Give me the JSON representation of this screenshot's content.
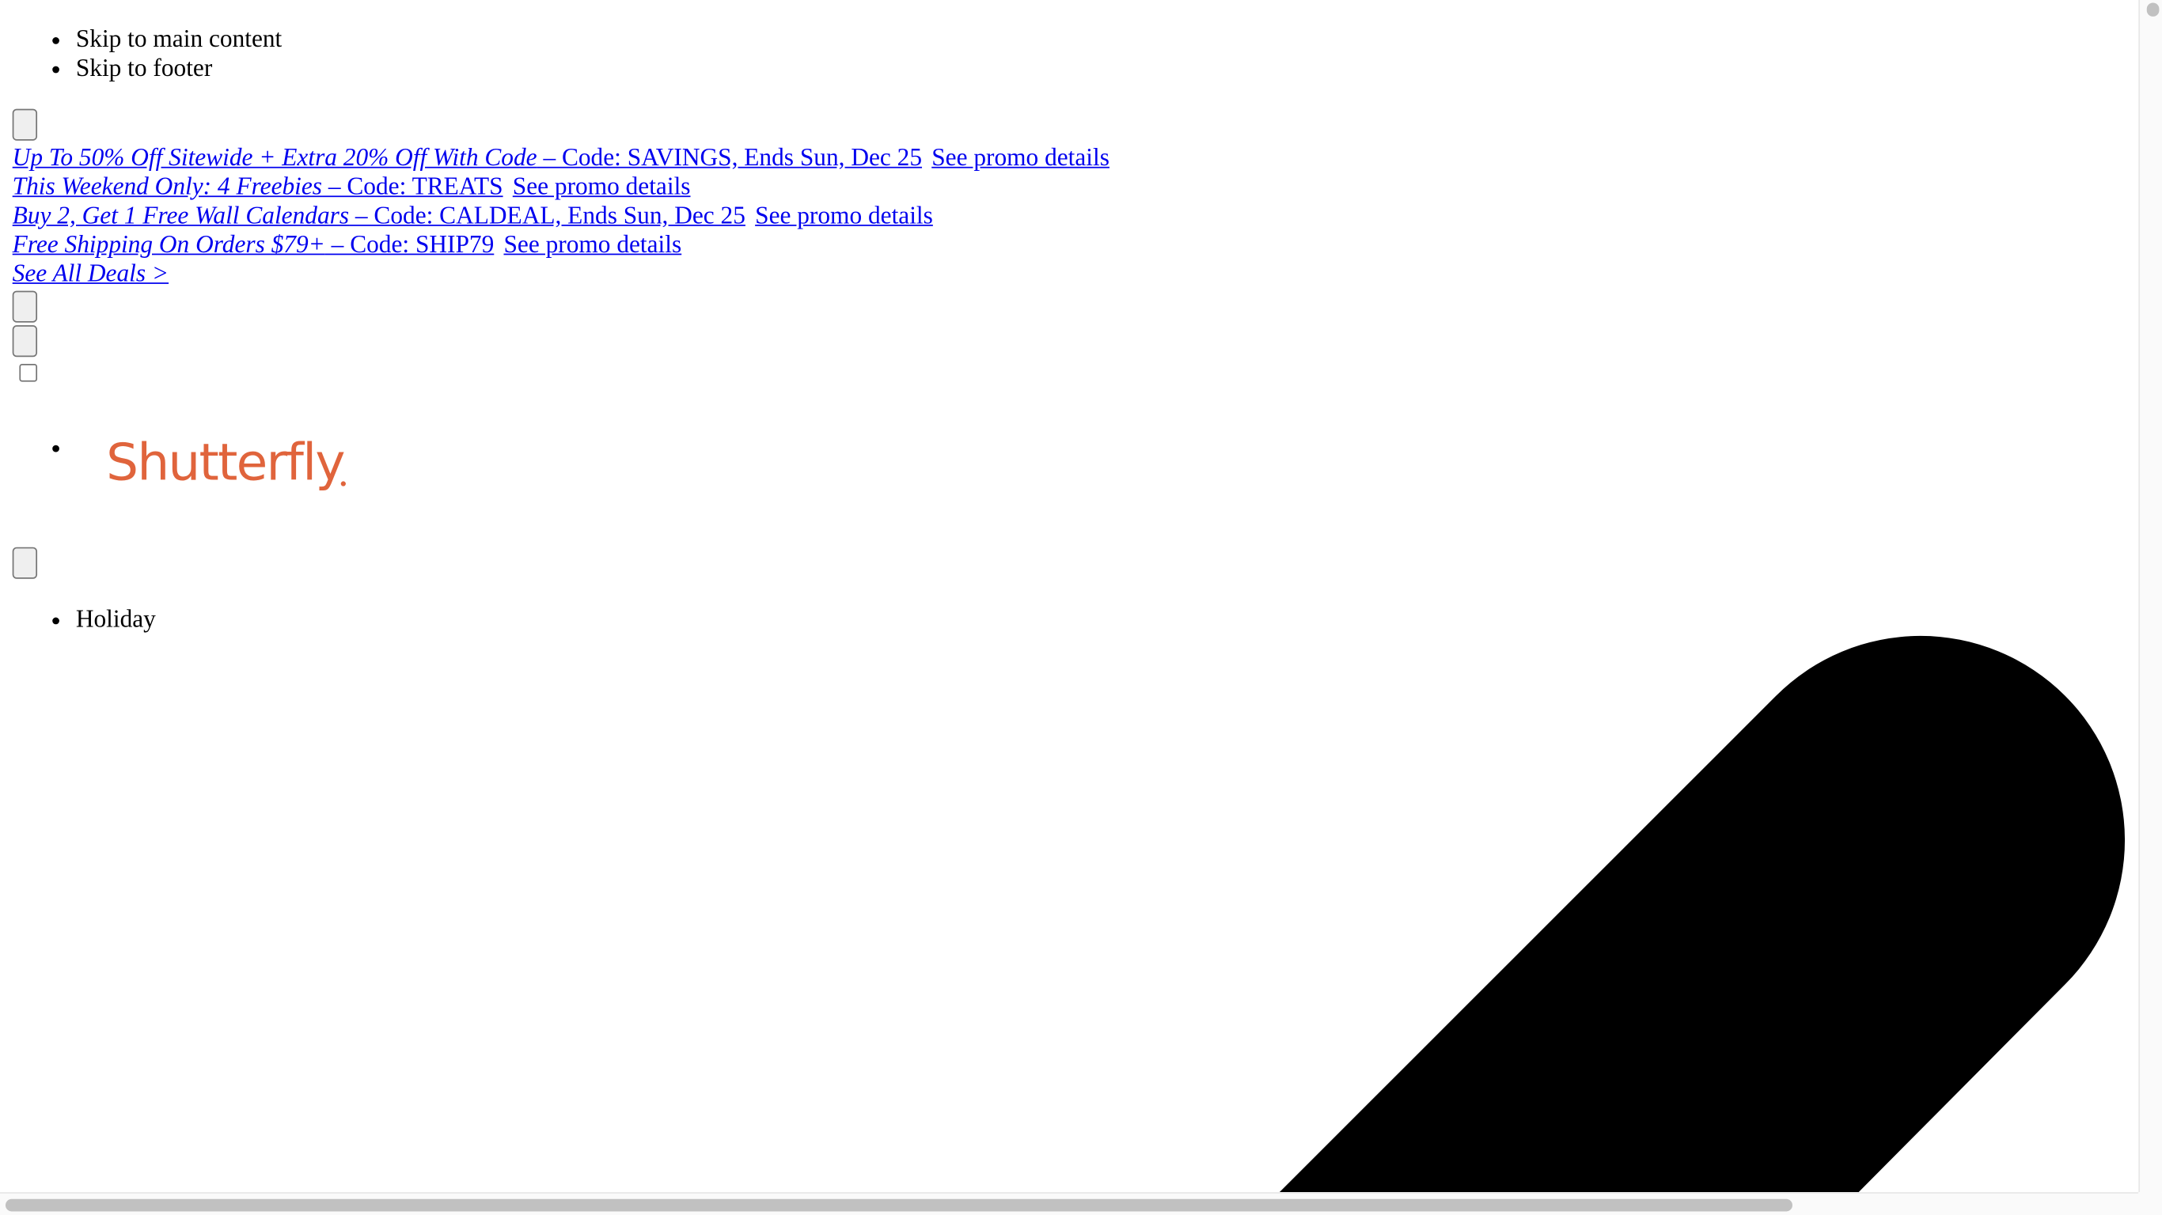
{
  "skip_links": [
    {
      "label": "Skip to main content"
    },
    {
      "label": "Skip to footer"
    }
  ],
  "promos": [
    {
      "deal": "Up To 50% Off Sitewide + Extra 20% Off With Code",
      "code_text": " – Code: SAVINGS, Ends Sun, Dec 25",
      "details": "See promo details"
    },
    {
      "deal": "This Weekend Only: 4 Freebies",
      "code_text": " – Code: TREATS",
      "details": "See promo details"
    },
    {
      "deal": "Buy 2, Get 1 Free Wall Calendars",
      "code_text": " – Code: CALDEAL, Ends Sun, Dec 25",
      "details": "See promo details"
    },
    {
      "deal": "Free Shipping On Orders $79+",
      "code_text": " – Code: SHIP79",
      "details": "See promo details"
    }
  ],
  "see_all_deals": "See All Deals >",
  "logo": {
    "text": "Shutterfly",
    "color": "#e0643c"
  },
  "nav": [
    {
      "label": "Holiday"
    }
  ],
  "colors": {
    "link": "#0000ee",
    "shape": "#000000"
  }
}
